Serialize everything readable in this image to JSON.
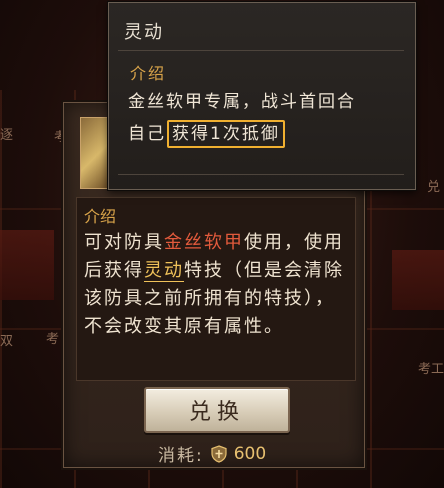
{
  "background": {
    "labels": [
      "逐",
      "考",
      "双",
      "考",
      "兑",
      "考工",
      "兑"
    ]
  },
  "tooltip": {
    "title": "灵动",
    "section": "介绍",
    "line1": "金丝软甲专属，战斗首回合",
    "line2_prefix": "自己",
    "line2_highlight": "获得1次抵御"
  },
  "item": {
    "section": "介绍",
    "desc_p1": "可对防具",
    "desc_item": "金丝软甲",
    "desc_p2": "使用，使用后获得",
    "desc_skill": "灵动",
    "desc_p3": "特技（但是会清除该防具之前所拥有的特技），不会改变其原有属性。"
  },
  "exchange": {
    "button_label": "兑换",
    "cost_label": "消耗:",
    "cost_value": "600"
  },
  "colors": {
    "accent_gold": "#d9a44a",
    "highlight_red": "#e25a3c",
    "highlight_border": "#f0b030"
  }
}
